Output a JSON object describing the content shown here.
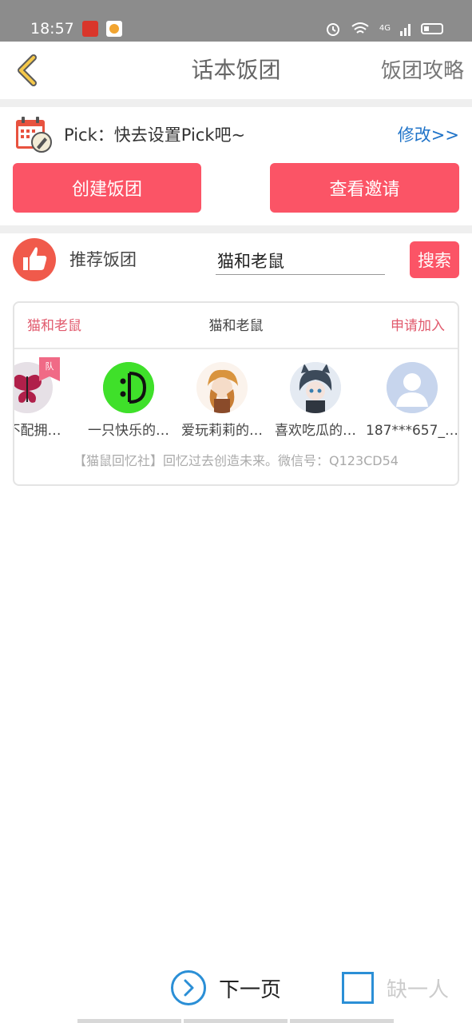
{
  "status_bar": {
    "time": "18:57",
    "network": "4G"
  },
  "nav": {
    "title": "话本饭团",
    "guide_label": "饭团攻略"
  },
  "pick": {
    "text": "Pick：快去设置Pick吧~",
    "edit_label": "修改>>"
  },
  "actions": {
    "create_label": "创建饭团",
    "invite_label": "查看邀请"
  },
  "recommend": {
    "label": "推荐饭团",
    "search_value": "猫和老鼠",
    "search_button": "搜索"
  },
  "group_card": {
    "left_label": "猫和老鼠",
    "center_label": "猫和老鼠",
    "join_label": "申请加入",
    "badge": "队",
    "members": [
      {
        "name": "是不配拥…",
        "avatar": "butterfly-avatar"
      },
      {
        "name": "一只快乐的…",
        "avatar": "smiley-avatar"
      },
      {
        "name": "爱玩莉莉的…",
        "avatar": "anime-girl-avatar"
      },
      {
        "name": "喜欢吃瓜的…",
        "avatar": "anime-cat-girl-avatar"
      },
      {
        "name": "187***657_…",
        "avatar": "default-user-avatar"
      }
    ],
    "description": "【猫鼠回忆社】回忆过去创造未来。微信号：Q123CD54"
  },
  "footer": {
    "next_label": "下一页",
    "missing_label": "缺一人"
  },
  "colors": {
    "accent": "#fb5466",
    "link": "#1f73c8",
    "blue_outline": "#2b8fd6"
  }
}
